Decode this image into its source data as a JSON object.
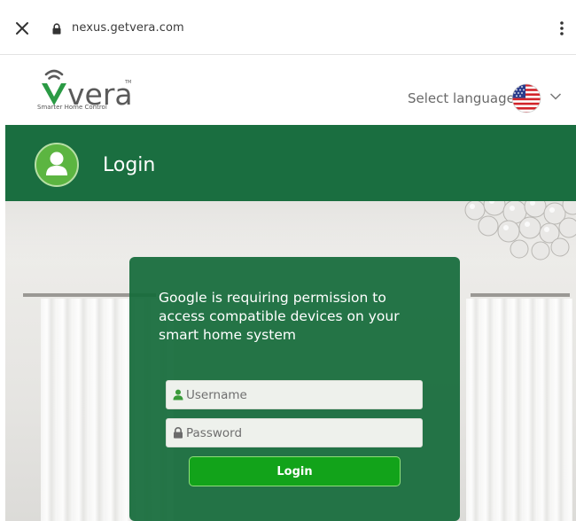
{
  "browser": {
    "url": "nexus.getvera.com"
  },
  "header": {
    "logo_text": "vera",
    "logo_tagline": "Smarter Home Control",
    "language_label": "Select language",
    "language_flag": "us-flag-icon"
  },
  "login_bar": {
    "title": "Login"
  },
  "card": {
    "message": "Google is requiring permission to access compatible devices on your smart home system",
    "username_placeholder": "Username",
    "password_placeholder": "Password",
    "login_button_label": "Login"
  },
  "colors": {
    "brand_green": "#1a6e40",
    "avatar_green": "#5cb541",
    "button_green": "#12a31a"
  }
}
